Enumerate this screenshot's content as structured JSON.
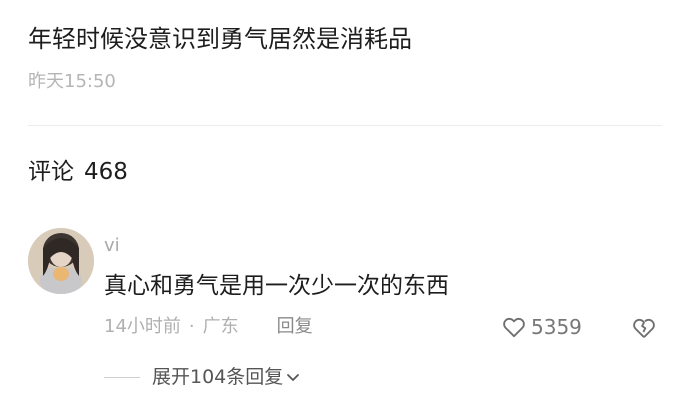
{
  "post": {
    "text": "年轻时候没意识到勇气居然是消耗品",
    "time": "昨天15:50"
  },
  "comments_section": {
    "label": "评论",
    "count": "468"
  },
  "comment": {
    "username": "vi",
    "text": "真心和勇气是用一次少一次的东西",
    "time_ago": "14小时前",
    "separator": "·",
    "location": "广东",
    "reply_label": "回复",
    "likes": "5359",
    "expand_replies_label": "展开104条回复"
  },
  "icons": {
    "like": "heart-outline-icon",
    "dislike": "broken-heart-icon",
    "expand": "chevron-down-icon"
  },
  "colors": {
    "text_primary": "#1d1d1d",
    "text_secondary": "#b0b0b0",
    "divider": "#ececec"
  }
}
